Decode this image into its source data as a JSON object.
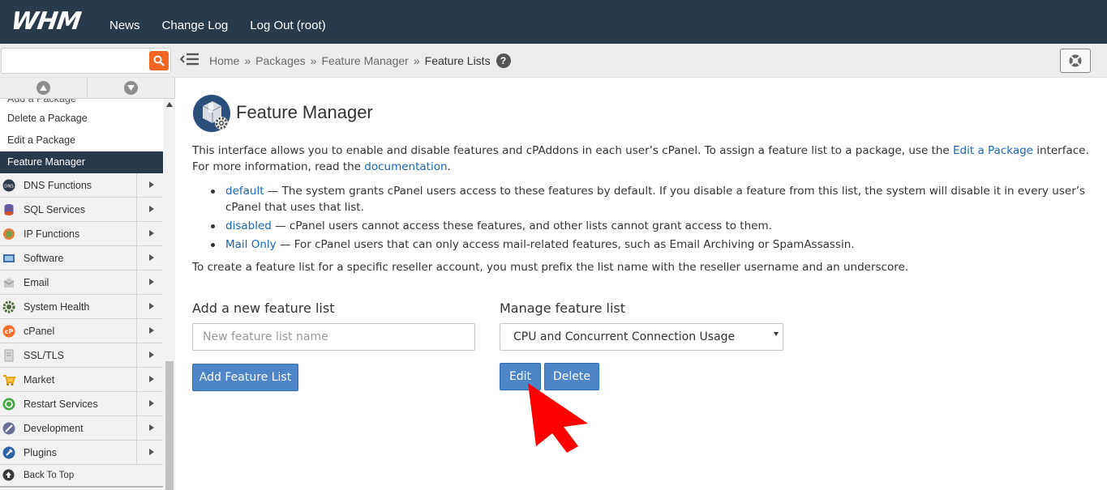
{
  "header": {
    "logo": "WHM",
    "nav": [
      "News",
      "Change Log",
      "Log Out (root)"
    ]
  },
  "search": {
    "value": "",
    "placeholder": ""
  },
  "breadcrumb": {
    "items": [
      "Home",
      "Packages",
      "Feature Manager"
    ],
    "separator": "»",
    "current": "Feature Lists"
  },
  "sidebar": {
    "partial_item": "Add a Package",
    "sub_items": [
      "Delete a Package",
      "Edit a Package",
      "Feature Manager"
    ],
    "active_item": "Feature Manager",
    "categories": [
      {
        "label": "DNS Functions",
        "icon": "dns-icon"
      },
      {
        "label": "SQL Services",
        "icon": "database-icon"
      },
      {
        "label": "IP Functions",
        "icon": "network-icon"
      },
      {
        "label": "Software",
        "icon": "software-icon"
      },
      {
        "label": "Email",
        "icon": "email-icon"
      },
      {
        "label": "System Health",
        "icon": "gear-icon"
      },
      {
        "label": "cPanel",
        "icon": "cpanel-icon"
      },
      {
        "label": "SSL/TLS",
        "icon": "certificate-icon"
      },
      {
        "label": "Market",
        "icon": "cart-icon"
      },
      {
        "label": "Restart Services",
        "icon": "restart-icon"
      },
      {
        "label": "Development",
        "icon": "development-icon"
      },
      {
        "label": "Plugins",
        "icon": "plugin-icon"
      }
    ],
    "back_to_top": "Back To Top"
  },
  "page": {
    "title": "Feature Manager",
    "intro_1": "This interface allows you to enable and disable features and cPAddons in each user’s cPanel. To assign a feature list to a package, use the ",
    "intro_link_1": "Edit a Package",
    "intro_2": " interface. For more information, read the ",
    "intro_link_2": "documentation",
    "intro_3": ".",
    "bullets": [
      {
        "link": "default",
        "text": " — The system grants cPanel users access to these features by default. If you disable a feature from this list, the system will disable it in every user’s cPanel that uses that list."
      },
      {
        "link": "disabled",
        "text": " — cPanel users cannot access these features, and other lists cannot grant access to them."
      },
      {
        "link": "Mail Only",
        "text": " — For cPanel users that can only access mail-related features, such as Email Archiving or SpamAssassin."
      }
    ],
    "reseller_note": "To create a feature list for a specific reseller account, you must prefix the list name with the reseller username and an underscore.",
    "add_section": {
      "label": "Add a new feature list",
      "input_value": "",
      "input_placeholder": "New feature list name",
      "button": "Add Feature List"
    },
    "manage_section": {
      "label": "Manage feature list",
      "selected": "CPU and Concurrent Connection Usage",
      "edit_button": "Edit",
      "delete_button": "Delete"
    }
  },
  "colors": {
    "topbar": "#293a4a",
    "accent_button": "#4c86c9",
    "search_button": "#f26522",
    "link": "#1a66b7",
    "pointer": "#ff0000"
  }
}
